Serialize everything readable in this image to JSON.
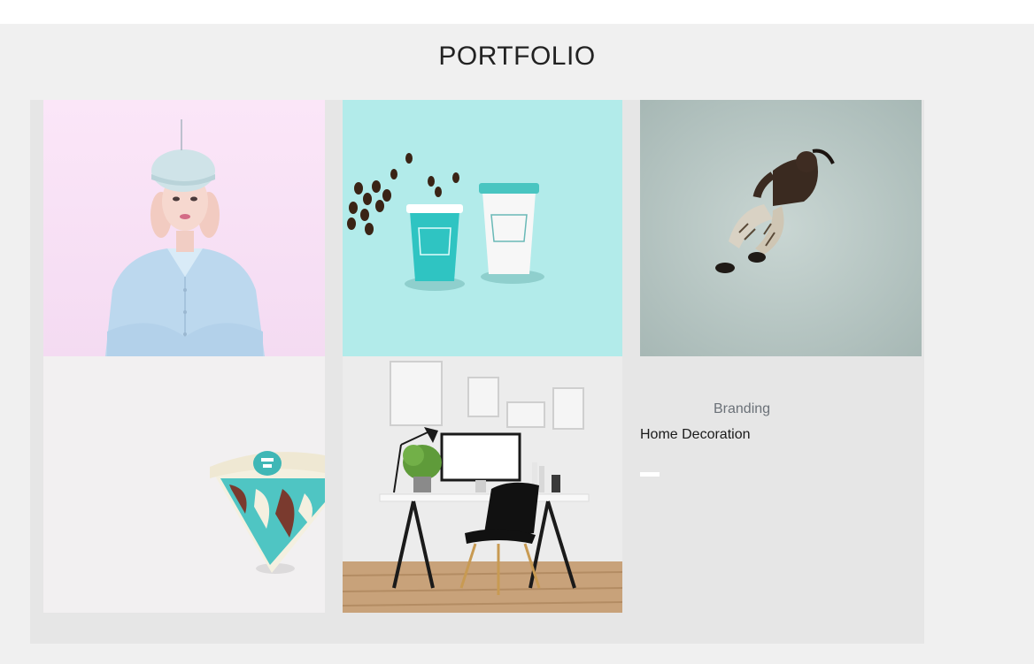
{
  "section": {
    "title": "PORTFOLIO"
  },
  "portfolio": {
    "items": [
      {
        "name": "portrait-woman",
        "icon": "portrait-photo"
      },
      {
        "name": "coffee-cups",
        "icon": "coffee-cups-photo"
      },
      {
        "name": "jumping-dancer",
        "icon": "dancer-photo"
      },
      {
        "name": "pie-packaging",
        "icon": "packaging-photo"
      },
      {
        "name": "desk-workspace",
        "icon": "workspace-photo"
      }
    ],
    "caption": {
      "category": "Branding",
      "title": "Home Decoration"
    }
  },
  "colors": {
    "page_bg": "#f0f0f0",
    "grid_bg": "#e6e6e6",
    "pink_bg": "#f8e1f4",
    "teal_bg": "#b2ebea",
    "gray_bg": "#aebfbd",
    "category_text": "#6b7178"
  }
}
